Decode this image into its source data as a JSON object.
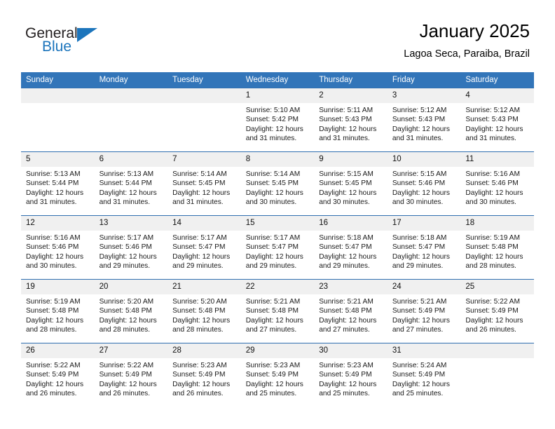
{
  "brand": {
    "name_part1": "General",
    "name_part2": "Blue",
    "accent_color": "#1c75bc"
  },
  "header": {
    "title": "January 2025",
    "subtitle": "Lagoa Seca, Paraiba, Brazil",
    "header_bg_color": "#3275b9",
    "daynum_bg_color": "#f0f0f0"
  },
  "weekday_headers": [
    "Sunday",
    "Monday",
    "Tuesday",
    "Wednesday",
    "Thursday",
    "Friday",
    "Saturday"
  ],
  "labels": {
    "sunrise_prefix": "Sunrise: ",
    "sunset_prefix": "Sunset: ",
    "daylight_prefix": "Daylight: "
  },
  "weeks": [
    [
      {
        "day": "",
        "empty": true
      },
      {
        "day": "",
        "empty": true
      },
      {
        "day": "",
        "empty": true
      },
      {
        "day": "1",
        "sunrise": "Sunrise: 5:10 AM",
        "sunset": "Sunset: 5:42 PM",
        "daylight_line1": "Daylight: 12 hours",
        "daylight_line2": "and 31 minutes."
      },
      {
        "day": "2",
        "sunrise": "Sunrise: 5:11 AM",
        "sunset": "Sunset: 5:43 PM",
        "daylight_line1": "Daylight: 12 hours",
        "daylight_line2": "and 31 minutes."
      },
      {
        "day": "3",
        "sunrise": "Sunrise: 5:12 AM",
        "sunset": "Sunset: 5:43 PM",
        "daylight_line1": "Daylight: 12 hours",
        "daylight_line2": "and 31 minutes."
      },
      {
        "day": "4",
        "sunrise": "Sunrise: 5:12 AM",
        "sunset": "Sunset: 5:43 PM",
        "daylight_line1": "Daylight: 12 hours",
        "daylight_line2": "and 31 minutes."
      }
    ],
    [
      {
        "day": "5",
        "sunrise": "Sunrise: 5:13 AM",
        "sunset": "Sunset: 5:44 PM",
        "daylight_line1": "Daylight: 12 hours",
        "daylight_line2": "and 31 minutes."
      },
      {
        "day": "6",
        "sunrise": "Sunrise: 5:13 AM",
        "sunset": "Sunset: 5:44 PM",
        "daylight_line1": "Daylight: 12 hours",
        "daylight_line2": "and 31 minutes."
      },
      {
        "day": "7",
        "sunrise": "Sunrise: 5:14 AM",
        "sunset": "Sunset: 5:45 PM",
        "daylight_line1": "Daylight: 12 hours",
        "daylight_line2": "and 31 minutes."
      },
      {
        "day": "8",
        "sunrise": "Sunrise: 5:14 AM",
        "sunset": "Sunset: 5:45 PM",
        "daylight_line1": "Daylight: 12 hours",
        "daylight_line2": "and 30 minutes."
      },
      {
        "day": "9",
        "sunrise": "Sunrise: 5:15 AM",
        "sunset": "Sunset: 5:45 PM",
        "daylight_line1": "Daylight: 12 hours",
        "daylight_line2": "and 30 minutes."
      },
      {
        "day": "10",
        "sunrise": "Sunrise: 5:15 AM",
        "sunset": "Sunset: 5:46 PM",
        "daylight_line1": "Daylight: 12 hours",
        "daylight_line2": "and 30 minutes."
      },
      {
        "day": "11",
        "sunrise": "Sunrise: 5:16 AM",
        "sunset": "Sunset: 5:46 PM",
        "daylight_line1": "Daylight: 12 hours",
        "daylight_line2": "and 30 minutes."
      }
    ],
    [
      {
        "day": "12",
        "sunrise": "Sunrise: 5:16 AM",
        "sunset": "Sunset: 5:46 PM",
        "daylight_line1": "Daylight: 12 hours",
        "daylight_line2": "and 30 minutes."
      },
      {
        "day": "13",
        "sunrise": "Sunrise: 5:17 AM",
        "sunset": "Sunset: 5:46 PM",
        "daylight_line1": "Daylight: 12 hours",
        "daylight_line2": "and 29 minutes."
      },
      {
        "day": "14",
        "sunrise": "Sunrise: 5:17 AM",
        "sunset": "Sunset: 5:47 PM",
        "daylight_line1": "Daylight: 12 hours",
        "daylight_line2": "and 29 minutes."
      },
      {
        "day": "15",
        "sunrise": "Sunrise: 5:17 AM",
        "sunset": "Sunset: 5:47 PM",
        "daylight_line1": "Daylight: 12 hours",
        "daylight_line2": "and 29 minutes."
      },
      {
        "day": "16",
        "sunrise": "Sunrise: 5:18 AM",
        "sunset": "Sunset: 5:47 PM",
        "daylight_line1": "Daylight: 12 hours",
        "daylight_line2": "and 29 minutes."
      },
      {
        "day": "17",
        "sunrise": "Sunrise: 5:18 AM",
        "sunset": "Sunset: 5:47 PM",
        "daylight_line1": "Daylight: 12 hours",
        "daylight_line2": "and 29 minutes."
      },
      {
        "day": "18",
        "sunrise": "Sunrise: 5:19 AM",
        "sunset": "Sunset: 5:48 PM",
        "daylight_line1": "Daylight: 12 hours",
        "daylight_line2": "and 28 minutes."
      }
    ],
    [
      {
        "day": "19",
        "sunrise": "Sunrise: 5:19 AM",
        "sunset": "Sunset: 5:48 PM",
        "daylight_line1": "Daylight: 12 hours",
        "daylight_line2": "and 28 minutes."
      },
      {
        "day": "20",
        "sunrise": "Sunrise: 5:20 AM",
        "sunset": "Sunset: 5:48 PM",
        "daylight_line1": "Daylight: 12 hours",
        "daylight_line2": "and 28 minutes."
      },
      {
        "day": "21",
        "sunrise": "Sunrise: 5:20 AM",
        "sunset": "Sunset: 5:48 PM",
        "daylight_line1": "Daylight: 12 hours",
        "daylight_line2": "and 28 minutes."
      },
      {
        "day": "22",
        "sunrise": "Sunrise: 5:21 AM",
        "sunset": "Sunset: 5:48 PM",
        "daylight_line1": "Daylight: 12 hours",
        "daylight_line2": "and 27 minutes."
      },
      {
        "day": "23",
        "sunrise": "Sunrise: 5:21 AM",
        "sunset": "Sunset: 5:48 PM",
        "daylight_line1": "Daylight: 12 hours",
        "daylight_line2": "and 27 minutes."
      },
      {
        "day": "24",
        "sunrise": "Sunrise: 5:21 AM",
        "sunset": "Sunset: 5:49 PM",
        "daylight_line1": "Daylight: 12 hours",
        "daylight_line2": "and 27 minutes."
      },
      {
        "day": "25",
        "sunrise": "Sunrise: 5:22 AM",
        "sunset": "Sunset: 5:49 PM",
        "daylight_line1": "Daylight: 12 hours",
        "daylight_line2": "and 26 minutes."
      }
    ],
    [
      {
        "day": "26",
        "sunrise": "Sunrise: 5:22 AM",
        "sunset": "Sunset: 5:49 PM",
        "daylight_line1": "Daylight: 12 hours",
        "daylight_line2": "and 26 minutes."
      },
      {
        "day": "27",
        "sunrise": "Sunrise: 5:22 AM",
        "sunset": "Sunset: 5:49 PM",
        "daylight_line1": "Daylight: 12 hours",
        "daylight_line2": "and 26 minutes."
      },
      {
        "day": "28",
        "sunrise": "Sunrise: 5:23 AM",
        "sunset": "Sunset: 5:49 PM",
        "daylight_line1": "Daylight: 12 hours",
        "daylight_line2": "and 26 minutes."
      },
      {
        "day": "29",
        "sunrise": "Sunrise: 5:23 AM",
        "sunset": "Sunset: 5:49 PM",
        "daylight_line1": "Daylight: 12 hours",
        "daylight_line2": "and 25 minutes."
      },
      {
        "day": "30",
        "sunrise": "Sunrise: 5:23 AM",
        "sunset": "Sunset: 5:49 PM",
        "daylight_line1": "Daylight: 12 hours",
        "daylight_line2": "and 25 minutes."
      },
      {
        "day": "31",
        "sunrise": "Sunrise: 5:24 AM",
        "sunset": "Sunset: 5:49 PM",
        "daylight_line1": "Daylight: 12 hours",
        "daylight_line2": "and 25 minutes."
      },
      {
        "day": "",
        "empty": true
      }
    ]
  ]
}
